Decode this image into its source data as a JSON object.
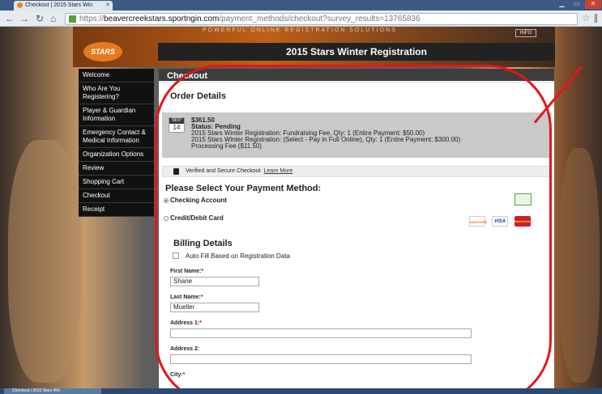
{
  "browser": {
    "tab_title": "Checkout | 2015 Stars Win",
    "url_prefix": "https://",
    "url_host": "beavercreekstars.sportngin.com",
    "url_path": "/payment_methods/checkout?survey_results=13765836"
  },
  "site": {
    "tagline": "POWERFUL ONLINE REGISTRATION SOLUTIONS",
    "info_button": "INFO",
    "logo_text": "STARS",
    "page_header": "2015 Stars Winter Registration"
  },
  "sidebar": {
    "items": [
      {
        "label": "Welcome"
      },
      {
        "label": "Who Are You Registering?"
      },
      {
        "label": "Player & Guardian Information"
      },
      {
        "label": "Emergency Contact & Medical Information"
      },
      {
        "label": "Organization Options"
      },
      {
        "label": "Review"
      },
      {
        "label": "Shopping Cart"
      },
      {
        "label": "Checkout"
      },
      {
        "label": "Receipt"
      }
    ]
  },
  "checkout": {
    "section_title": "Checkout",
    "order_title": "Order Details",
    "order": {
      "month": "SEP",
      "day": "14",
      "amount": "$361.50",
      "status": "Status: Pending",
      "lines": [
        "2015 Stars Winter Registration: Fundraising Fee, Qty: 1 (Entire Payment: $50.00)",
        "2015 Stars Winter Registration: (Select - Pay in Full Online), Qty: 1 (Entire Payment: $300.00)",
        "Processing Fee ($11.50)"
      ]
    },
    "secure_text": "Verified and Secure Checkout",
    "learn_more": "Learn More",
    "payment_title": "Please Select Your Payment Method:",
    "methods": [
      {
        "label": "Checking Account",
        "selected": true
      },
      {
        "label": "Credit/Debit Card",
        "selected": false
      }
    ],
    "cards": [
      "DISCOVER",
      "VISA",
      "MasterCard"
    ]
  },
  "billing": {
    "title": "Billing Details",
    "autofill_label": "Auto Fill Based on Registration Data",
    "autofill_checked": false,
    "fields": {
      "first_name_label": "First Name:",
      "first_name_value": "Shane",
      "last_name_label": "Last Name:",
      "last_name_value": "Mueller",
      "address1_label": "Address 1:",
      "address1_value": "",
      "address2_label": "Address 2:",
      "address2_value": "",
      "city_label": "City:"
    },
    "required_mark": "*"
  },
  "colors": {
    "annotation_red": "#e4161a",
    "sidebar_bg": "#111111",
    "accent_orange": "#e47a21"
  },
  "taskbar": {
    "item": "Checkout | 2015 Stars Win"
  }
}
